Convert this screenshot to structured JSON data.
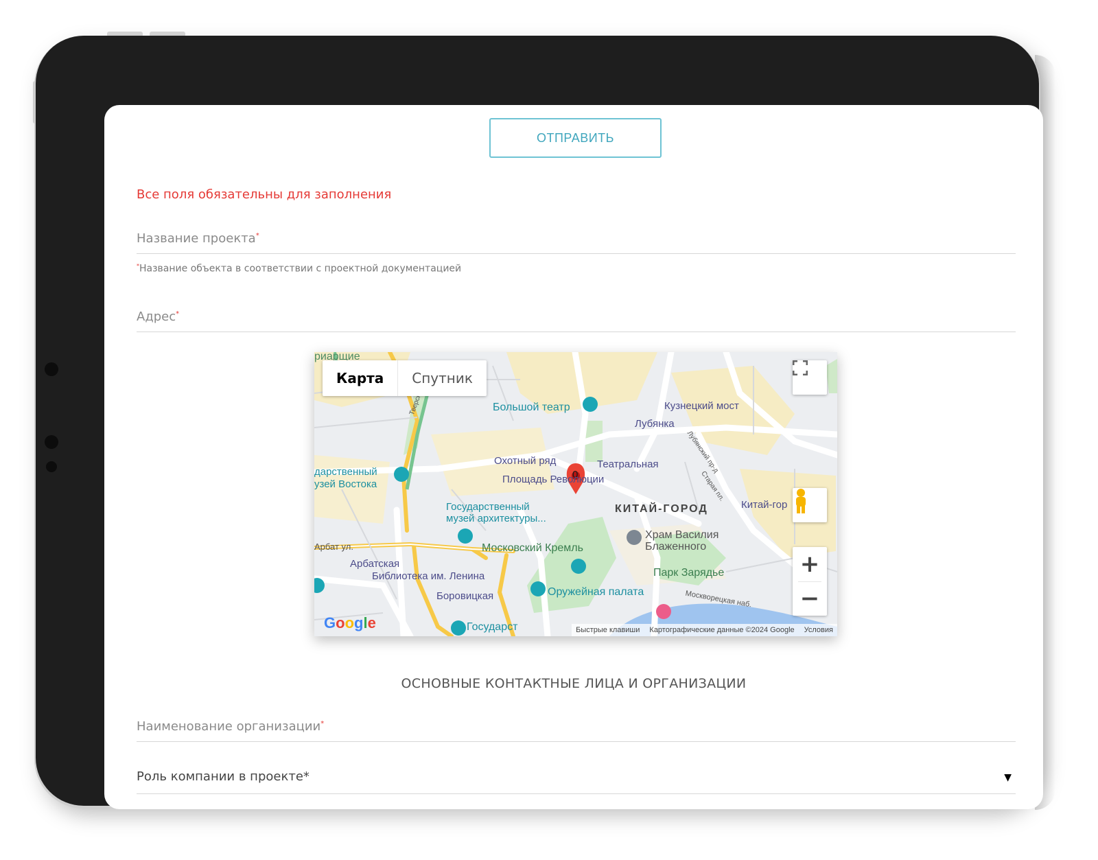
{
  "form": {
    "submit_label": "ОТПРАВИТЬ",
    "required_note": "Все поля обязательны для заполнения",
    "project_name_label": "Название проекта",
    "project_name_hint": "Название объекта в соответствии с проектной документацией",
    "address_label": "Адрес",
    "required_marker": "*",
    "section_title": "ОСНОВНЫЕ КОНТАКТНЫЕ ЛИЦА И ОРГАНИЗАЦИИ",
    "org_name_label": "Наименование организации",
    "company_role_label": "Роль компании в проекте*",
    "company_role_caret": "▼"
  },
  "map": {
    "type_map": "Карта",
    "type_satellite": "Спутник",
    "zoom_in": "+",
    "zoom_out": "−",
    "marker_label": "0",
    "google": "Google",
    "attribution": [
      "Быстрые клавиши",
      "Картографические данные ©2024 Google",
      "Условия"
    ],
    "places": {
      "bolshoi": "Большой театр",
      "kuznetsky": "Кузнецкий мост",
      "lubyanka": "Лубянка",
      "okhotny": "Охотный ряд",
      "teatralnaya": "Театральная",
      "ploshchad": "Площадь Революции",
      "museum_east_1": "дарственный",
      "museum_east_2": "узей Востока",
      "gos_museum_1": "Государственный",
      "gos_museum_2": "музей архитектуры...",
      "kitai_gorod": "КИТАЙ-ГОРОД",
      "kitai_gorod_metro": "Китай-гор",
      "vasily_1": "Храм Василия",
      "vasily_2": "Блаженного",
      "arbat": "Арбат ул.",
      "kreml": "Московский Кремль",
      "arbatskaya": "Арбатская",
      "library": "Библиотека им. Ленина",
      "zaryadye": "Парк Зарядье",
      "borovitskaya": "Боровицкая",
      "armoury": "Оружейная палата",
      "moskvoretskaya": "Москворецкая наб.",
      "gosudarst": "Государст",
      "tverskoy": "Тверской",
      "lubyansky": "Лубянский пр-д",
      "staraya": "Старая пл.",
      "top_cut": "риарщие"
    }
  }
}
